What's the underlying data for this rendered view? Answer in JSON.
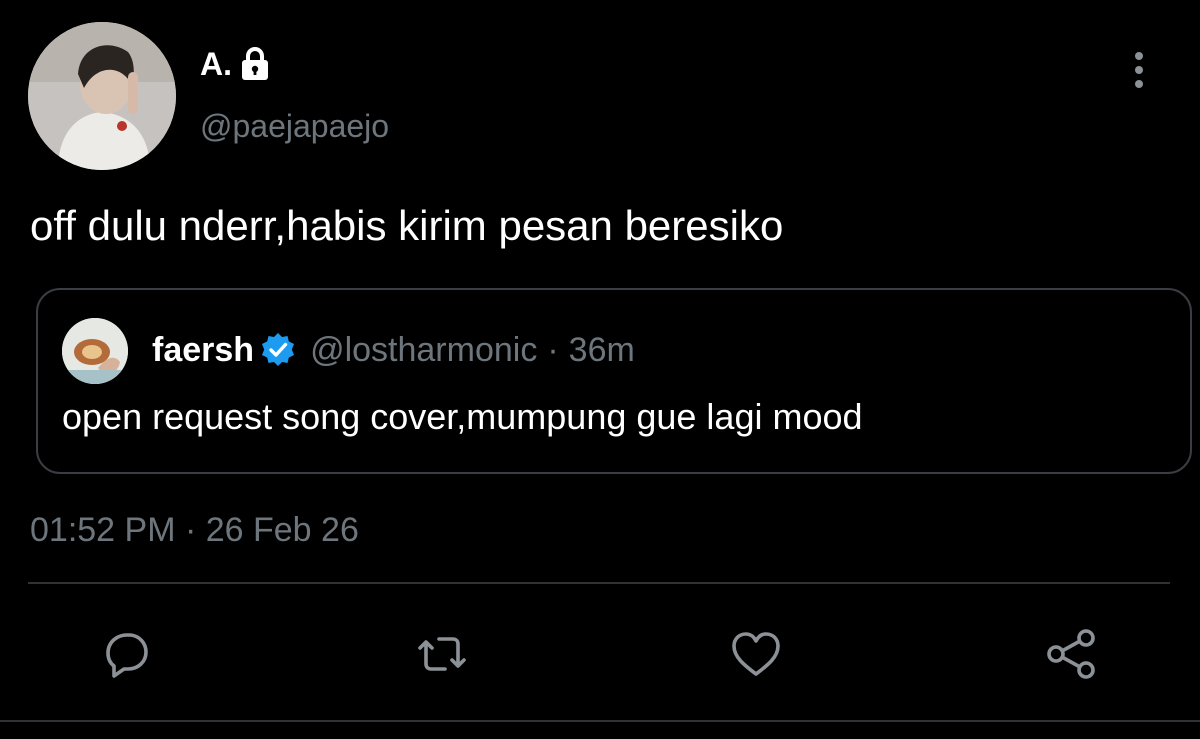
{
  "tweet": {
    "author": {
      "display_name": "A.",
      "handle": "@paejapaejo",
      "protected_icon": "lock-icon",
      "avatar_icon": "profile-photo"
    },
    "text": "off dulu nderr,habis kirim pesan beresiko",
    "quoted_tweet": {
      "author_name": "faersh",
      "verified_icon": "verified-badge-icon",
      "handle": "@lostharmonic",
      "separator": "·",
      "time": "36m",
      "text": "open request song cover,mumpung gue lagi mood"
    },
    "timestamp": "01:52 PM · 26 Feb 26",
    "more_icon": "more-vertical-icon"
  },
  "actions": [
    {
      "name": "reply",
      "icon": "reply-icon"
    },
    {
      "name": "retweet",
      "icon": "retweet-icon"
    },
    {
      "name": "like",
      "icon": "heart-icon"
    },
    {
      "name": "share",
      "icon": "share-icon"
    }
  ],
  "colors": {
    "background": "#000000",
    "text_primary": "#ffffff",
    "text_secondary": "#6e767d",
    "border": "#3a3d41",
    "verified": "#1d9bf0"
  }
}
